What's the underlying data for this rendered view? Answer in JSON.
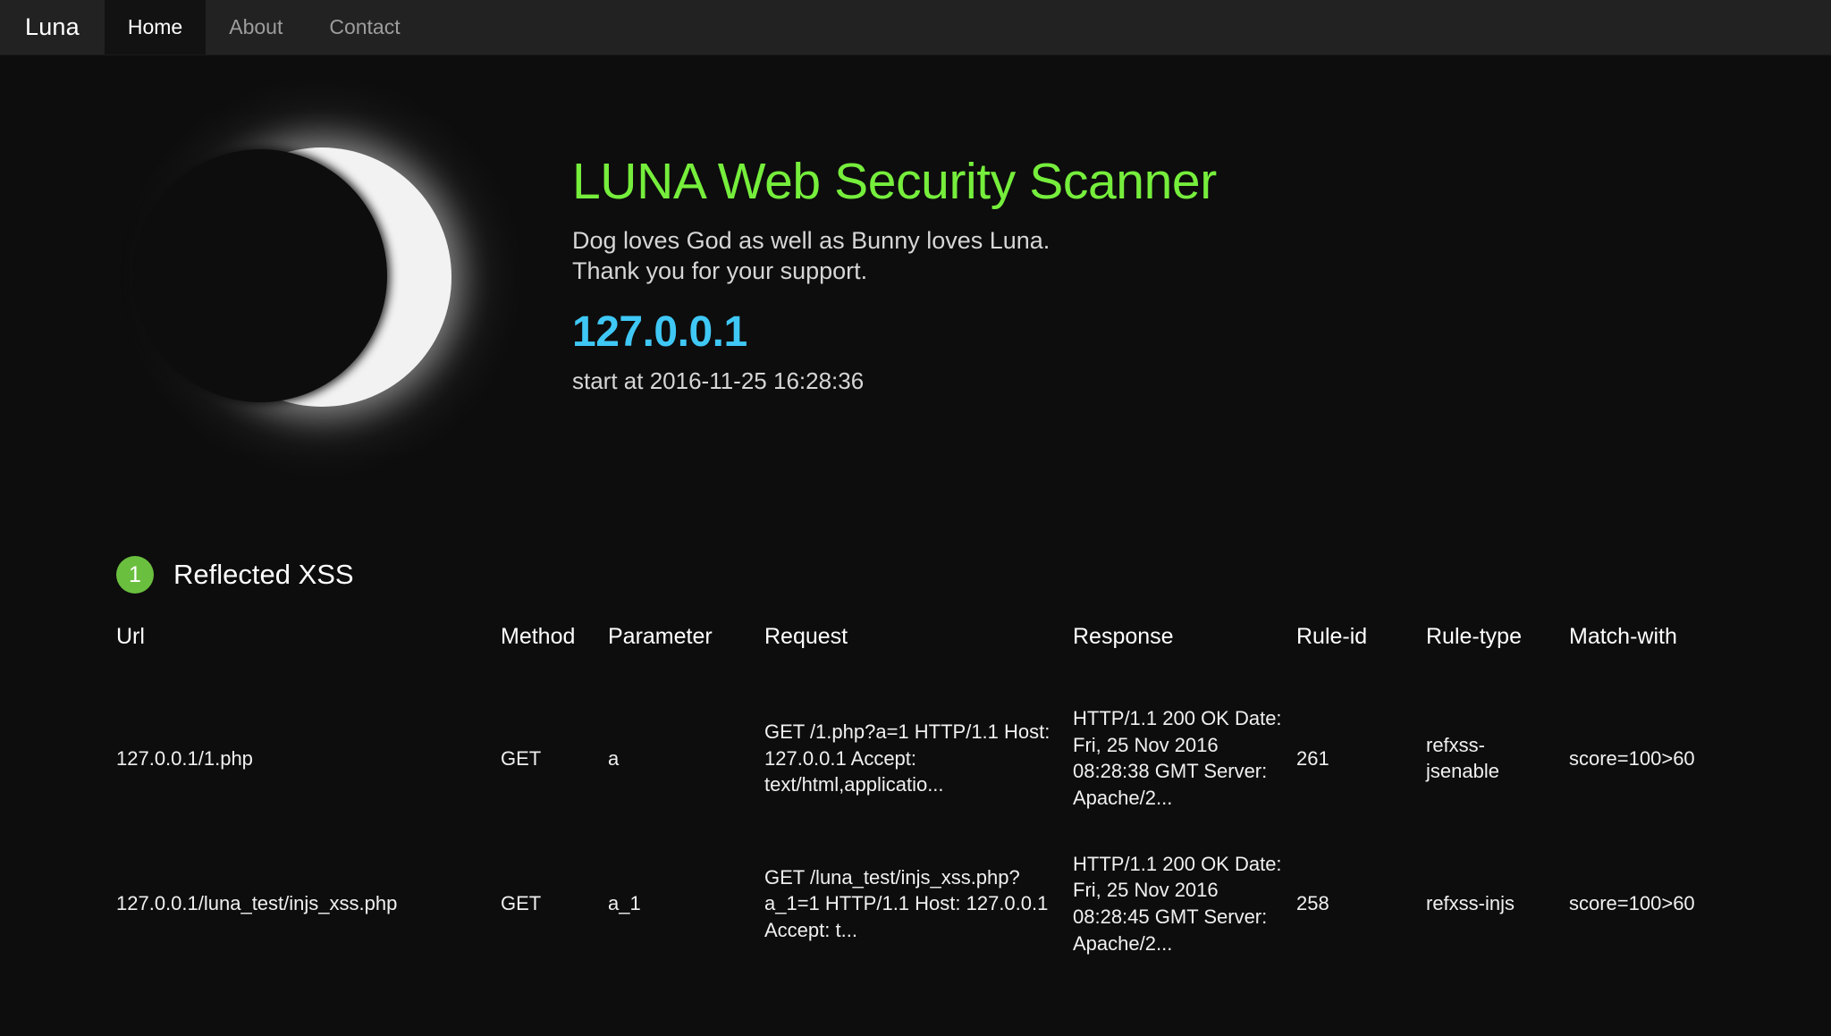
{
  "navbar": {
    "brand": "Luna",
    "items": [
      {
        "label": "Home",
        "active": true
      },
      {
        "label": "About",
        "active": false
      },
      {
        "label": "Contact",
        "active": false
      }
    ]
  },
  "hero": {
    "logo_icon": "crescent-moon-icon",
    "title": "LUNA Web Security Scanner",
    "subtitle_line1": "Dog loves God as well as Bunny loves Luna.",
    "subtitle_line2": "Thank you for your support.",
    "target_ip": "127.0.0.1",
    "start_time": "start at 2016-11-25 16:28:36"
  },
  "colors": {
    "accent_green": "#76ee3c",
    "accent_cyan": "#3fc8f5",
    "badge_green": "#6bbf3f",
    "background": "#0d0d0d",
    "navbar": "#222222"
  },
  "results": {
    "section": {
      "badge": "1",
      "title": "Reflected XSS"
    },
    "columns": [
      "Url",
      "Method",
      "Parameter",
      "Request",
      "Response",
      "Rule-id",
      "Rule-type",
      "Match-with"
    ],
    "rows": [
      {
        "url": "127.0.0.1/1.php",
        "method": "GET",
        "parameter": "a",
        "request": "GET /1.php?a=1 HTTP/1.1 Host: 127.0.0.1 Accept: text/html,applicatio...",
        "response": "HTTP/1.1 200 OK Date: Fri, 25 Nov 2016 08:28:38 GMT Server: Apache/2...",
        "rule_id": "261",
        "rule_type": "refxss-jsenable",
        "match_with": "score=100>60"
      },
      {
        "url": "127.0.0.1/luna_test/injs_xss.php",
        "method": "GET",
        "parameter": "a_1",
        "request": "GET /luna_test/injs_xss.php?a_1=1 HTTP/1.1 Host: 127.0.0.1 Accept: t...",
        "response": "HTTP/1.1 200 OK Date: Fri, 25 Nov 2016 08:28:45 GMT Server: Apache/2...",
        "rule_id": "258",
        "rule_type": "refxss-injs",
        "match_with": "score=100>60"
      }
    ]
  }
}
